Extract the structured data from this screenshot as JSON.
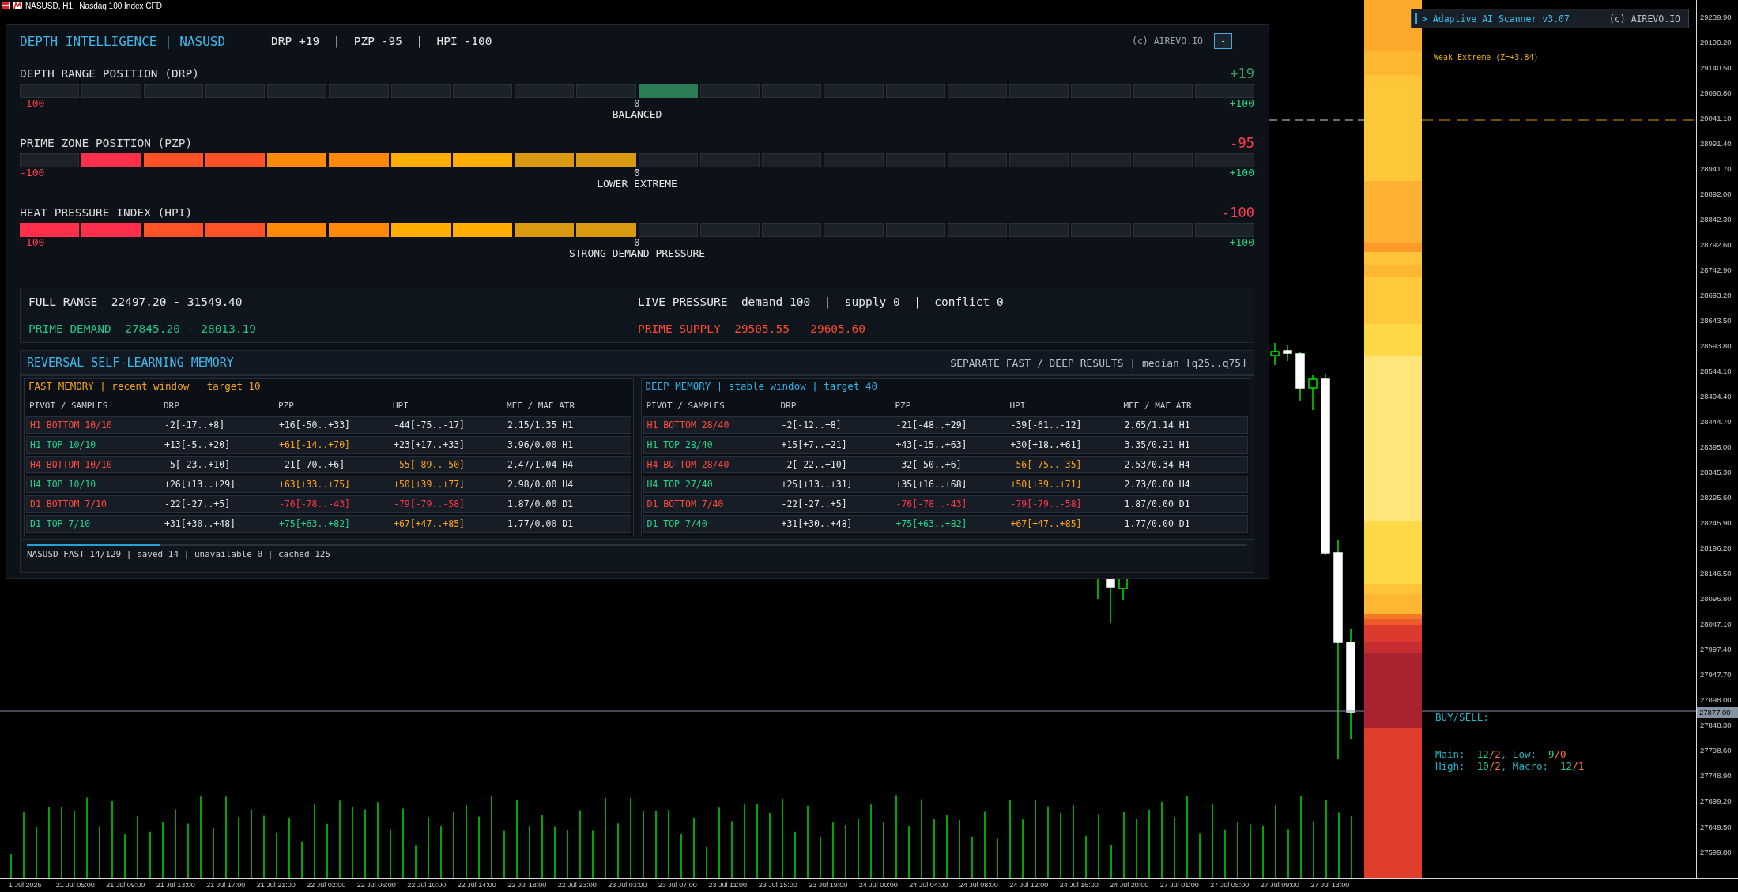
{
  "chart_title": "NASUSD, H1:  Nasdaq 100 Index CFD",
  "panel": {
    "title": "DEPTH INTELLIGENCE | NASUSD",
    "summary": "DRP +19  |  PZP -95  |  HPI -100",
    "credit": "(c) AIREVO.IO",
    "collapse": "-"
  },
  "gauges": [
    {
      "title": "DEPTH RANGE POSITION (DRP)",
      "value": "+19",
      "segments": [
        {
          "lit": false
        },
        {
          "lit": false
        },
        {
          "lit": false
        },
        {
          "lit": false
        },
        {
          "lit": false
        },
        {
          "lit": false
        },
        {
          "lit": false
        },
        {
          "lit": false
        },
        {
          "lit": false
        },
        {
          "lit": false
        },
        {
          "lit": true
        },
        {
          "lit": false
        },
        {
          "lit": false
        },
        {
          "lit": false
        },
        {
          "lit": false
        },
        {
          "lit": false
        },
        {
          "lit": false
        },
        {
          "lit": false
        },
        {
          "lit": false
        },
        {
          "lit": false
        }
      ],
      "min_label": "-100",
      "mid_label": "0",
      "max_label": "+100",
      "status": "BALANCED"
    },
    {
      "title": "PRIME ZONE POSITION (PZP)",
      "value": "-95",
      "segments": [
        {
          "lit": false
        },
        {
          "lit": true
        },
        {
          "lit": true
        },
        {
          "lit": true
        },
        {
          "lit": true
        },
        {
          "lit": true
        },
        {
          "lit": true
        },
        {
          "lit": true
        },
        {
          "lit": true
        },
        {
          "lit": true
        },
        {
          "lit": false
        },
        {
          "lit": false
        },
        {
          "lit": false
        },
        {
          "lit": false
        },
        {
          "lit": false
        },
        {
          "lit": false
        },
        {
          "lit": false
        },
        {
          "lit": false
        },
        {
          "lit": false
        },
        {
          "lit": false
        }
      ],
      "min_label": "-100",
      "mid_label": "0",
      "max_label": "+100",
      "status": "LOWER EXTREME"
    },
    {
      "title": "HEAT PRESSURE INDEX (HPI)",
      "value": "-100",
      "segments": [
        {
          "lit": true
        },
        {
          "lit": true
        },
        {
          "lit": true
        },
        {
          "lit": true
        },
        {
          "lit": true
        },
        {
          "lit": true
        },
        {
          "lit": true
        },
        {
          "lit": true
        },
        {
          "lit": true
        },
        {
          "lit": true
        },
        {
          "lit": false
        },
        {
          "lit": false
        },
        {
          "lit": false
        },
        {
          "lit": false
        },
        {
          "lit": false
        },
        {
          "lit": false
        },
        {
          "lit": false
        },
        {
          "lit": false
        },
        {
          "lit": false
        },
        {
          "lit": false
        }
      ],
      "min_label": "-100",
      "mid_label": "0",
      "max_label": "+100",
      "status": "STRONG DEMAND PRESSURE"
    }
  ],
  "info": [
    {
      "label": "FULL RANGE",
      "value": "22497.20 - 31549.40",
      "color": "#e6e6e6"
    },
    {
      "label": "LIVE PRESSURE",
      "value": "demand 100  |  supply 0  |  conflict 0",
      "color": "#e6e6e6"
    },
    {
      "label": "PRIME DEMAND",
      "value": "27845.20 - 28013.19",
      "color": "#22c38a"
    },
    {
      "label": "PRIME SUPPLY",
      "value": "29505.55 - 29605.60",
      "color": "#ff4a2e"
    }
  ],
  "memory": {
    "title": "REVERSAL SELF-LEARNING MEMORY",
    "note": "SEPARATE FAST / DEEP RESULTS | median [q25..q75]",
    "panels": [
      {
        "heading": "FAST MEMORY | recent window | target 10",
        "color": "#f5a21f",
        "columns": [
          "PIVOT / SAMPLES",
          "DRP",
          "PZP",
          "HPI",
          "MFE / MAE ATR"
        ],
        "rows": [
          {
            "cells": [
              {
                "text": "H1 BOTTOM 10/10",
                "color": "#ff4a3a"
              },
              {
                "text": "-2[-17..+8]",
                "color": "#e6e6e6"
              },
              {
                "text": "+16[-50..+33]",
                "color": "#e6e6e6"
              },
              {
                "text": "-44[-75..-17]",
                "color": "#e6e6e6"
              },
              {
                "text": "2.15/1.35 H1",
                "color": "#e6e6e6"
              }
            ]
          },
          {
            "cells": [
              {
                "text": "H1 TOP 10/10",
                "color": "#22d38a"
              },
              {
                "text": "+13[-5..+20]",
                "color": "#e6e6e6"
              },
              {
                "text": "+61[-14..+70]",
                "color": "#ffa21a"
              },
              {
                "text": "+23[+17..+33]",
                "color": "#e6e6e6"
              },
              {
                "text": "3.96/0.00 H1",
                "color": "#e6e6e6"
              }
            ]
          },
          {
            "cells": [
              {
                "text": "H4 BOTTOM 10/10",
                "color": "#ff4a3a"
              },
              {
                "text": "-5[-23..+10]",
                "color": "#e6e6e6"
              },
              {
                "text": "-21[-70..+6]",
                "color": "#e6e6e6"
              },
              {
                "text": "-55[-89..-50]",
                "color": "#ffa21a"
              },
              {
                "text": "2.47/1.04 H4",
                "color": "#e6e6e6"
              }
            ]
          },
          {
            "cells": [
              {
                "text": "H4 TOP 10/10",
                "color": "#22d38a"
              },
              {
                "text": "+26[+13..+29]",
                "color": "#e6e6e6"
              },
              {
                "text": "+63[+33..+75]",
                "color": "#ffa21a"
              },
              {
                "text": "+50[+39..+77]",
                "color": "#ffa21a"
              },
              {
                "text": "2.98/0.00 H4",
                "color": "#e6e6e6"
              }
            ]
          },
          {
            "cells": [
              {
                "text": "D1 BOTTOM 7/10",
                "color": "#ff4a3a"
              },
              {
                "text": "-22[-27..+5]",
                "color": "#e6e6e6"
              },
              {
                "text": "-76[-78..-43]",
                "color": "#ff3448"
              },
              {
                "text": "-79[-79..-58]",
                "color": "#ff3448"
              },
              {
                "text": "1.87/0.00 D1",
                "color": "#e6e6e6"
              }
            ]
          },
          {
            "cells": [
              {
                "text": "D1 TOP 7/10",
                "color": "#22d38a"
              },
              {
                "text": "+31[+30..+48]",
                "color": "#e6e6e6"
              },
              {
                "text": "+75[+63..+82]",
                "color": "#22d38a"
              },
              {
                "text": "+67[+47..+85]",
                "color": "#ffa21a"
              },
              {
                "text": "1.77/0.00 D1",
                "color": "#e6e6e6"
              }
            ]
          }
        ]
      },
      {
        "heading": "DEEP MEMORY | stable window | target 40",
        "color": "#2fb4e6",
        "columns": [
          "PIVOT / SAMPLES",
          "DRP",
          "PZP",
          "HPI",
          "MFE / MAE ATR"
        ],
        "rows": [
          {
            "cells": [
              {
                "text": "H1 BOTTOM 28/40",
                "color": "#ff4a3a"
              },
              {
                "text": "-2[-12..+8]",
                "color": "#e6e6e6"
              },
              {
                "text": "-21[-48..+29]",
                "color": "#e6e6e6"
              },
              {
                "text": "-39[-61..-12]",
                "color": "#e6e6e6"
              },
              {
                "text": "2.65/1.14 H1",
                "color": "#e6e6e6"
              }
            ]
          },
          {
            "cells": [
              {
                "text": "H1 TOP 28/40",
                "color": "#22d38a"
              },
              {
                "text": "+15[+7..+21]",
                "color": "#e6e6e6"
              },
              {
                "text": "+43[-15..+63]",
                "color": "#e6e6e6"
              },
              {
                "text": "+30[+18..+61]",
                "color": "#e6e6e6"
              },
              {
                "text": "3.35/0.21 H1",
                "color": "#e6e6e6"
              }
            ]
          },
          {
            "cells": [
              {
                "text": "H4 BOTTOM 28/40",
                "color": "#ff4a3a"
              },
              {
                "text": "-2[-22..+10]",
                "color": "#e6e6e6"
              },
              {
                "text": "-32[-50..+6]",
                "color": "#e6e6e6"
              },
              {
                "text": "-56[-75..-35]",
                "color": "#ffa21a"
              },
              {
                "text": "2.53/0.34 H4",
                "color": "#e6e6e6"
              }
            ]
          },
          {
            "cells": [
              {
                "text": "H4 TOP 27/40",
                "color": "#22d38a"
              },
              {
                "text": "+25[+13..+31]",
                "color": "#e6e6e6"
              },
              {
                "text": "+35[+16..+68]",
                "color": "#e6e6e6"
              },
              {
                "text": "+50[+39..+71]",
                "color": "#ffa21a"
              },
              {
                "text": "2.73/0.00 H4",
                "color": "#e6e6e6"
              }
            ]
          },
          {
            "cells": [
              {
                "text": "D1 BOTTOM 7/40",
                "color": "#ff4a3a"
              },
              {
                "text": "-22[-27..+5]",
                "color": "#e6e6e6"
              },
              {
                "text": "-76[-78..-43]",
                "color": "#ff3448"
              },
              {
                "text": "-79[-79..-58]",
                "color": "#ff3448"
              },
              {
                "text": "1.87/0.00 D1",
                "color": "#e6e6e6"
              }
            ]
          },
          {
            "cells": [
              {
                "text": "D1 TOP 7/40",
                "color": "#22d38a"
              },
              {
                "text": "+31[+30..+48]",
                "color": "#e6e6e6"
              },
              {
                "text": "+75[+63..+82]",
                "color": "#22d38a"
              },
              {
                "text": "+67[+47..+85]",
                "color": "#ffa21a"
              },
              {
                "text": "1.77/0.00 D1",
                "color": "#e6e6e6"
              }
            ]
          }
        ]
      }
    ],
    "footer": {
      "text": "NASUSD FAST 14/129 | saved 14 | unavailable 0 | cached 125",
      "level": 0.109
    }
  },
  "scanner": {
    "title": "> Adaptive AI Scanner v3.07",
    "credit": "(c) AIREVO.IO"
  },
  "zone_label": "Weak Extreme (Z=+3.84)",
  "buy_sell": {
    "title": "BUY/SELL:",
    "lines": [
      [
        {
          "text": "Main:  ",
          "color": "#1fb5c9"
        },
        {
          "text": "12",
          "color": "#22d38a"
        },
        {
          "text": "/2",
          "color": "#ff7a1a"
        },
        {
          "text": ", Low:  ",
          "color": "#1fb5c9"
        },
        {
          "text": "9",
          "color": "#22d38a"
        },
        {
          "text": "/0",
          "color": "#ff7a1a"
        }
      ],
      [
        {
          "text": "High:  ",
          "color": "#1fb5c9"
        },
        {
          "text": "10",
          "color": "#22d38a"
        },
        {
          "text": "/2",
          "color": "#ff7a1a"
        },
        {
          "text": ", Macro:  ",
          "color": "#1fb5c9"
        },
        {
          "text": "12",
          "color": "#22d38a"
        },
        {
          "text": "/1",
          "color": "#ff7a1a"
        }
      ]
    ]
  },
  "price_axis": {
    "ticks": [
      "29239.90",
      "29190.20",
      "29140.50",
      "29090.80",
      "29041.10",
      "28991.40",
      "28941.70",
      "28892.00",
      "28842.30",
      "28792.60",
      "28742.90",
      "28693.20",
      "28643.50",
      "28593.80",
      "28544.10",
      "28494.40",
      "28444.70",
      "28395.00",
      "28345.30",
      "28295.60",
      "28245.90",
      "28196.20",
      "28146.50",
      "28096.80",
      "28047.10",
      "27997.40",
      "27947.70",
      "27898.00",
      "27848.30",
      "27798.60",
      "27748.90",
      "27699.20",
      "27649.50",
      "27599.80"
    ],
    "current": "27877.00"
  },
  "time_axis": [
    "1 Jul 2026",
    "21 Jul 05:00",
    "21 Jul 09:00",
    "21 Jul 13:00",
    "21 Jul 17:00",
    "21 Jul 21:00",
    "22 Jul 02:00",
    "22 Jul 06:00",
    "22 Jul 10:00",
    "22 Jul 14:00",
    "22 Jul 18:00",
    "22 Jul 23:00",
    "23 Jul 03:00",
    "23 Jul 07:00",
    "23 Jul 11:00",
    "23 Jul 15:00",
    "23 Jul 19:00",
    "24 Jul 00:00",
    "24 Jul 04:00",
    "24 Jul 08:00",
    "24 Jul 12:00",
    "24 Jul 16:00",
    "24 Jul 20:00",
    "27 Jul 01:00",
    "27 Jul 05:00",
    "27 Jul 09:00",
    "27 Jul 13:00"
  ]
}
